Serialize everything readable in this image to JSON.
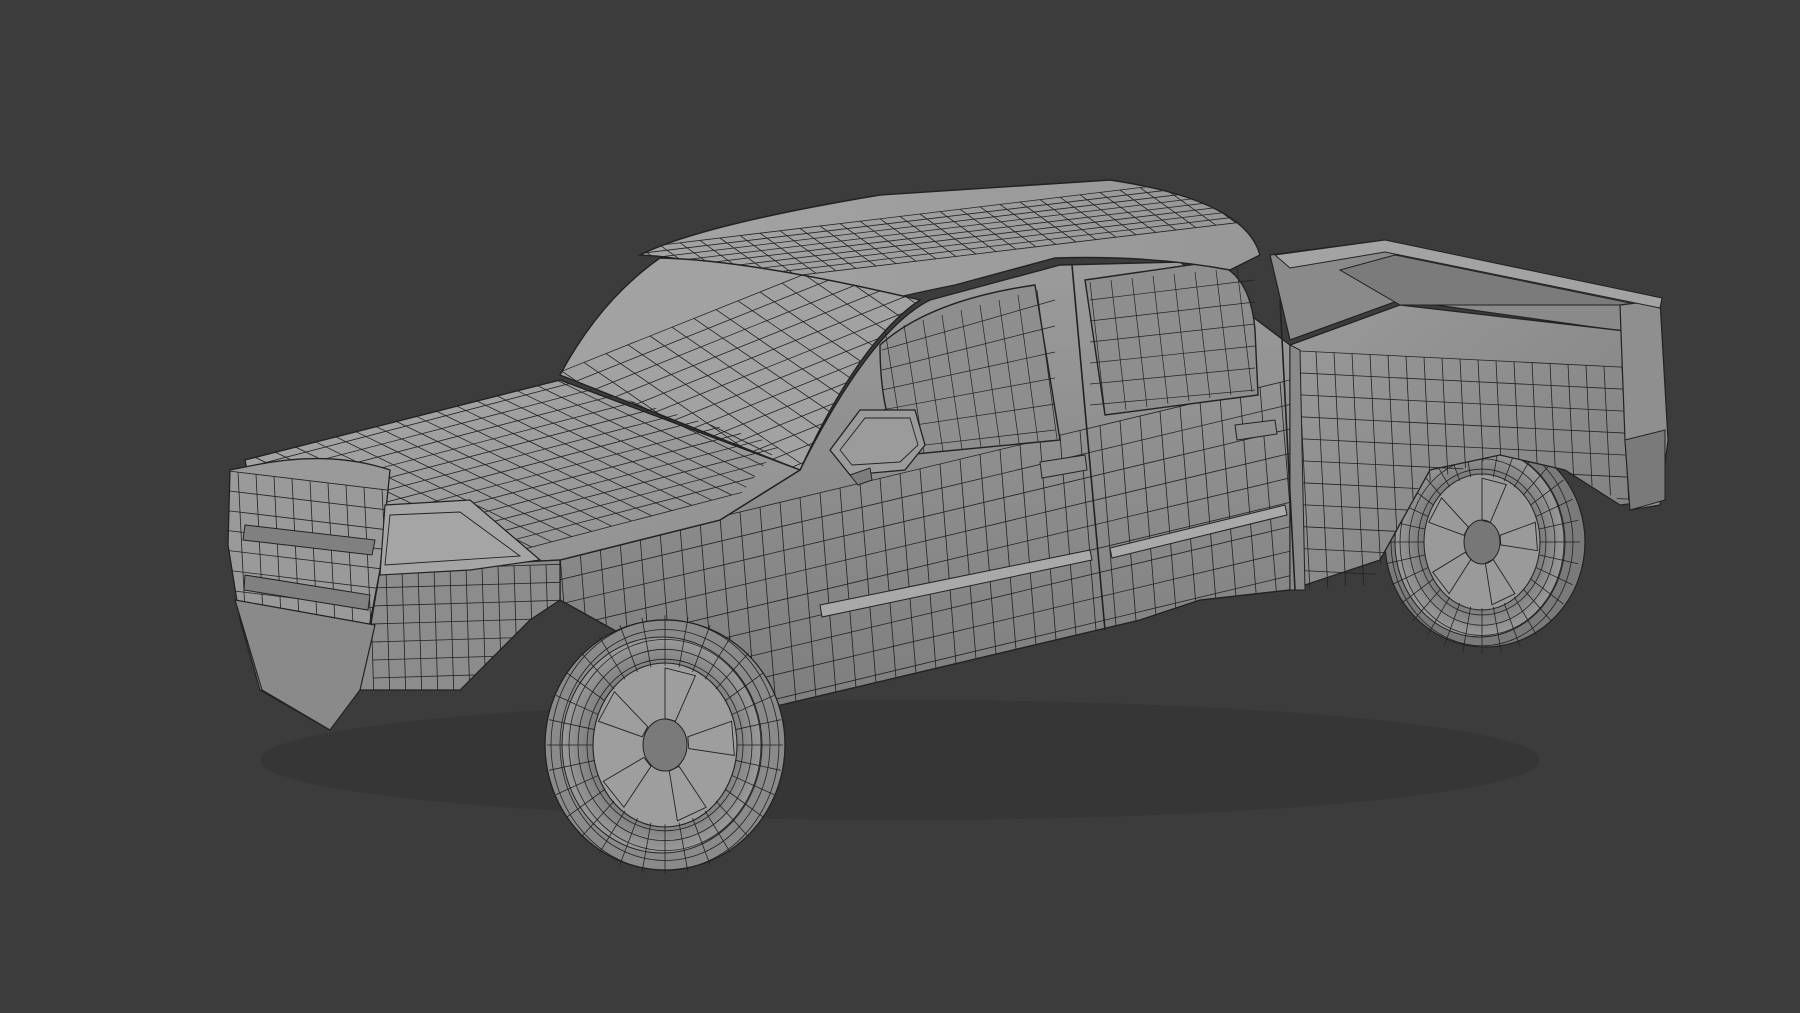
{
  "scene": {
    "background_color": "#3c3c3c",
    "object": "pickup-truck-wireframe-mesh",
    "shading": "solid-with-wireframe",
    "colors": {
      "body_light": "#a6a6a6",
      "body_mid": "#939393",
      "body_dark": "#7c7c7c",
      "body_shadow": "#5e5e5e",
      "glass": "#8d8d8d",
      "tire": "#8a8a8a",
      "rim": "#9c9c9c",
      "wire": "#222222"
    },
    "icons": {
      "truck": "pickup-truck-icon"
    }
  }
}
